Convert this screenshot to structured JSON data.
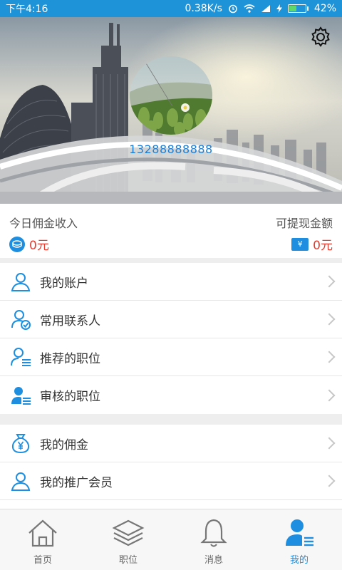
{
  "status_bar": {
    "time": "下午4:16",
    "network_speed": "0.38K/s",
    "battery": "42%",
    "battery_level": 0.42
  },
  "profile": {
    "phone": "13288888888"
  },
  "earnings": {
    "today_label": "今日佣金收入",
    "today_value": "0元",
    "withdraw_label": "可提现金额",
    "withdraw_value": "0元",
    "withdraw_symbol": "¥"
  },
  "menu_group1": [
    {
      "label": "我的账户"
    },
    {
      "label": "常用联系人"
    },
    {
      "label": "推荐的职位"
    },
    {
      "label": "审核的职位"
    }
  ],
  "menu_group2": [
    {
      "label": "我的佣金"
    },
    {
      "label": "我的推广会员"
    }
  ],
  "tabs": [
    {
      "label": "首页"
    },
    {
      "label": "职位"
    },
    {
      "label": "消息"
    },
    {
      "label": "我的"
    }
  ],
  "colors": {
    "accent": "#1e8fe0",
    "amount": "#e63b2e",
    "status_bar": "#1f93d8"
  }
}
